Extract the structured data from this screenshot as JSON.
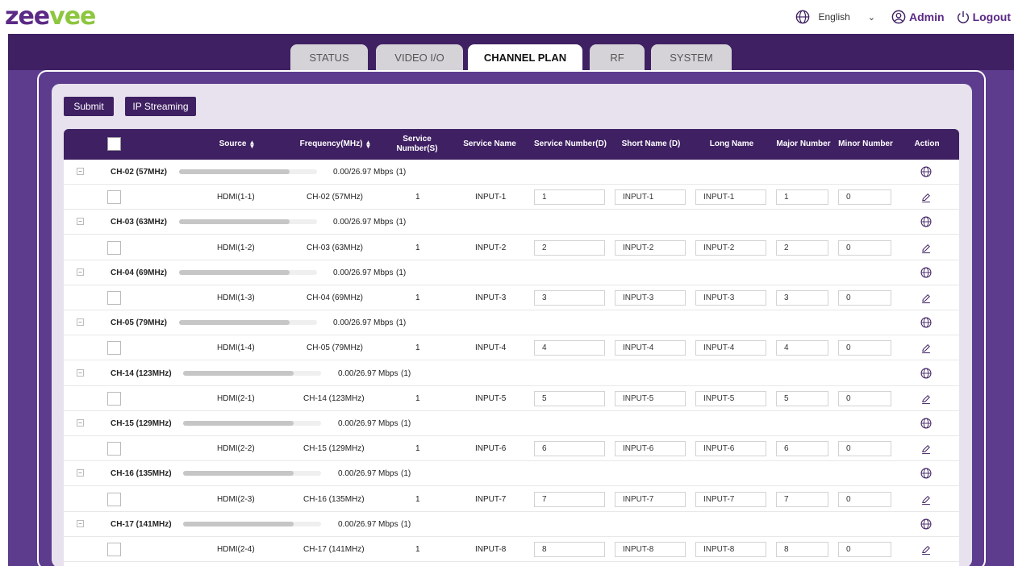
{
  "header": {
    "logo_text_zee": "zee",
    "logo_text_vee": "vee",
    "language": "English",
    "user": "Admin",
    "logout": "Logout"
  },
  "tabs": [
    {
      "label": "STATUS",
      "active": false
    },
    {
      "label": "VIDEO I/O",
      "active": false
    },
    {
      "label": "CHANNEL PLAN",
      "active": true
    },
    {
      "label": "RF",
      "active": false
    },
    {
      "label": "SYSTEM",
      "active": false
    }
  ],
  "toolbar": {
    "submit": "Submit",
    "ip_streaming": "IP Streaming"
  },
  "table": {
    "headers": {
      "source": "Source",
      "frequency": "Frequency(MHz)",
      "service_number_s": "Service Number(S)",
      "service_name": "Service Name",
      "service_number_d": "Service Number(D)",
      "short_name": "Short Name (D)",
      "long_name": "Long Name",
      "major": "Major Number",
      "minor": "Minor Number",
      "action": "Action"
    },
    "groups": [
      {
        "channel": "CH-02 (57MHz)",
        "rate": "0.00/26.97 Mbps",
        "count": "(1)",
        "fill": 0.8,
        "source": "HDMI(1-1)",
        "frequency": "CH-02 (57MHz)",
        "svc_s": "1",
        "svc_name": "INPUT-1",
        "svc_d": "1",
        "short": "INPUT-1",
        "long": "INPUT-1",
        "major": "1",
        "minor": "0"
      },
      {
        "channel": "CH-03 (63MHz)",
        "rate": "0.00/26.97 Mbps",
        "count": "(1)",
        "fill": 0.8,
        "source": "HDMI(1-2)",
        "frequency": "CH-03 (63MHz)",
        "svc_s": "1",
        "svc_name": "INPUT-2",
        "svc_d": "2",
        "short": "INPUT-2",
        "long": "INPUT-2",
        "major": "2",
        "minor": "0"
      },
      {
        "channel": "CH-04 (69MHz)",
        "rate": "0.00/26.97 Mbps",
        "count": "(1)",
        "fill": 0.8,
        "source": "HDMI(1-3)",
        "frequency": "CH-04 (69MHz)",
        "svc_s": "1",
        "svc_name": "INPUT-3",
        "svc_d": "3",
        "short": "INPUT-3",
        "long": "INPUT-3",
        "major": "3",
        "minor": "0"
      },
      {
        "channel": "CH-05 (79MHz)",
        "rate": "0.00/26.97 Mbps",
        "count": "(1)",
        "fill": 0.8,
        "source": "HDMI(1-4)",
        "frequency": "CH-05 (79MHz)",
        "svc_s": "1",
        "svc_name": "INPUT-4",
        "svc_d": "4",
        "short": "INPUT-4",
        "long": "INPUT-4",
        "major": "4",
        "minor": "0"
      },
      {
        "channel": "CH-14 (123MHz)",
        "rate": "0.00/26.97 Mbps",
        "count": "(1)",
        "fill": 0.8,
        "source": "HDMI(2-1)",
        "frequency": "CH-14 (123MHz)",
        "svc_s": "1",
        "svc_name": "INPUT-5",
        "svc_d": "5",
        "short": "INPUT-5",
        "long": "INPUT-5",
        "major": "5",
        "minor": "0"
      },
      {
        "channel": "CH-15 (129MHz)",
        "rate": "0.00/26.97 Mbps",
        "count": "(1)",
        "fill": 0.8,
        "source": "HDMI(2-2)",
        "frequency": "CH-15 (129MHz)",
        "svc_s": "1",
        "svc_name": "INPUT-6",
        "svc_d": "6",
        "short": "INPUT-6",
        "long": "INPUT-6",
        "major": "6",
        "minor": "0"
      },
      {
        "channel": "CH-16 (135MHz)",
        "rate": "0.00/26.97 Mbps",
        "count": "(1)",
        "fill": 0.8,
        "source": "HDMI(2-3)",
        "frequency": "CH-16 (135MHz)",
        "svc_s": "1",
        "svc_name": "INPUT-7",
        "svc_d": "7",
        "short": "INPUT-7",
        "long": "INPUT-7",
        "major": "7",
        "minor": "0"
      },
      {
        "channel": "CH-17 (141MHz)",
        "rate": "0.00/26.97 Mbps",
        "count": "(1)",
        "fill": 0.8,
        "source": "HDMI(2-4)",
        "frequency": "CH-17 (141MHz)",
        "svc_s": "1",
        "svc_name": "INPUT-8",
        "svc_d": "8",
        "short": "INPUT-8",
        "long": "INPUT-8",
        "major": "8",
        "minor": "0"
      }
    ]
  },
  "colors": {
    "brand_purple": "#3f2063",
    "logo_green": "#8dc63f",
    "bg_purple": "#5d3b8d"
  },
  "icons": {
    "language": "globe-icon",
    "user": "user-circle-icon",
    "logout": "power-icon",
    "group_action": "globe-icon",
    "row_action": "pencil-icon",
    "collapse": "minus-square-icon"
  }
}
